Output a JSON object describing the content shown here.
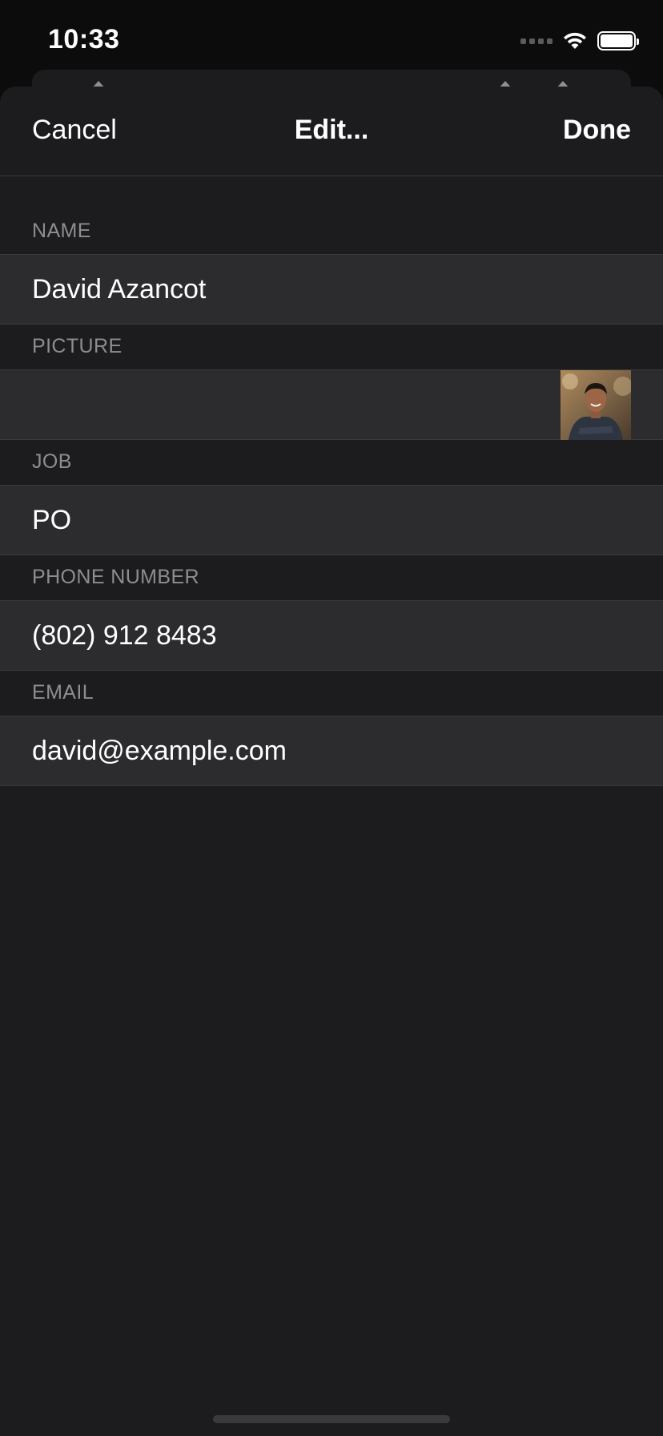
{
  "status_bar": {
    "time": "10:33"
  },
  "nav": {
    "cancel_label": "Cancel",
    "title": "Edit...",
    "done_label": "Done"
  },
  "form": {
    "name": {
      "header": "NAME",
      "value": "David Azancot"
    },
    "picture": {
      "header": "PICTURE",
      "image": "profile-photo"
    },
    "job": {
      "header": "JOB",
      "value": "PO"
    },
    "phone": {
      "header": "PHONE NUMBER",
      "value": "(802) 912 8483"
    },
    "email": {
      "header": "EMAIL",
      "value": "david@example.com"
    }
  },
  "colors": {
    "sheet_background": "#1c1c1e",
    "row_background": "#2c2c2e",
    "header_text": "#8d8d92",
    "text": "#ffffff"
  }
}
